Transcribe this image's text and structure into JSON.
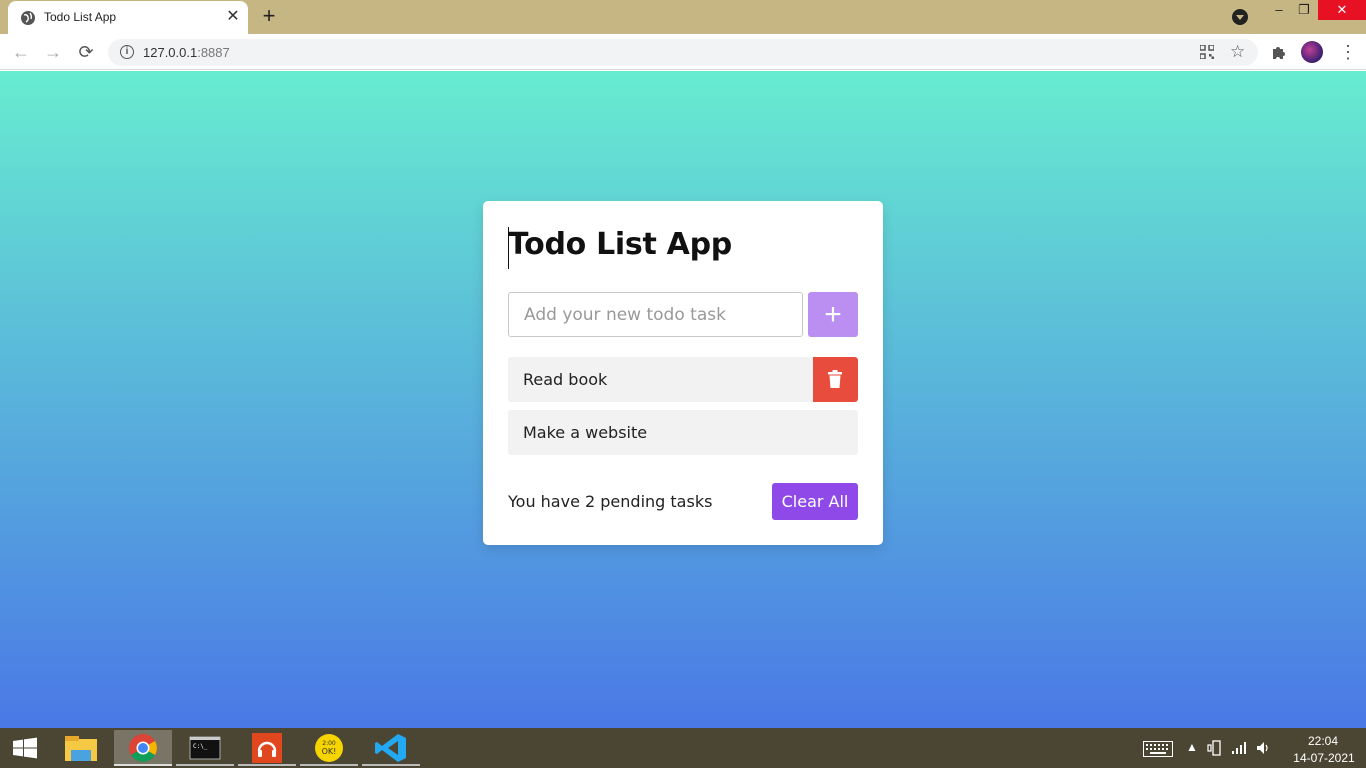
{
  "browser": {
    "tab_title": "Todo List App",
    "tab_close": "✕",
    "new_tab": "+",
    "url_host": "127.0.0.1",
    "url_port": ":8887",
    "window_min": "–",
    "window_restore": "❐",
    "window_close": "✕"
  },
  "app": {
    "title": "Todo List App",
    "input_placeholder": "Add your new todo task",
    "input_value": "",
    "add_label": "+",
    "todos": [
      {
        "text": "Read book"
      },
      {
        "text": "Make a website"
      }
    ],
    "pending_text": "You have 2 pending tasks",
    "clear_label": "Clear All"
  },
  "taskbar": {
    "time": "22:04",
    "date": "14-07-2021",
    "apps": [
      "file-explorer-icon",
      "chrome-icon",
      "terminal-icon",
      "music-player-icon",
      "ok-badge-icon",
      "vscode-icon"
    ]
  },
  "colors": {
    "gradient_top": "#67ecd0",
    "gradient_bottom": "#4a78e6",
    "add_button": "#bb8ef1",
    "delete_button": "#e74c3c",
    "clear_button": "#8e49e8"
  }
}
